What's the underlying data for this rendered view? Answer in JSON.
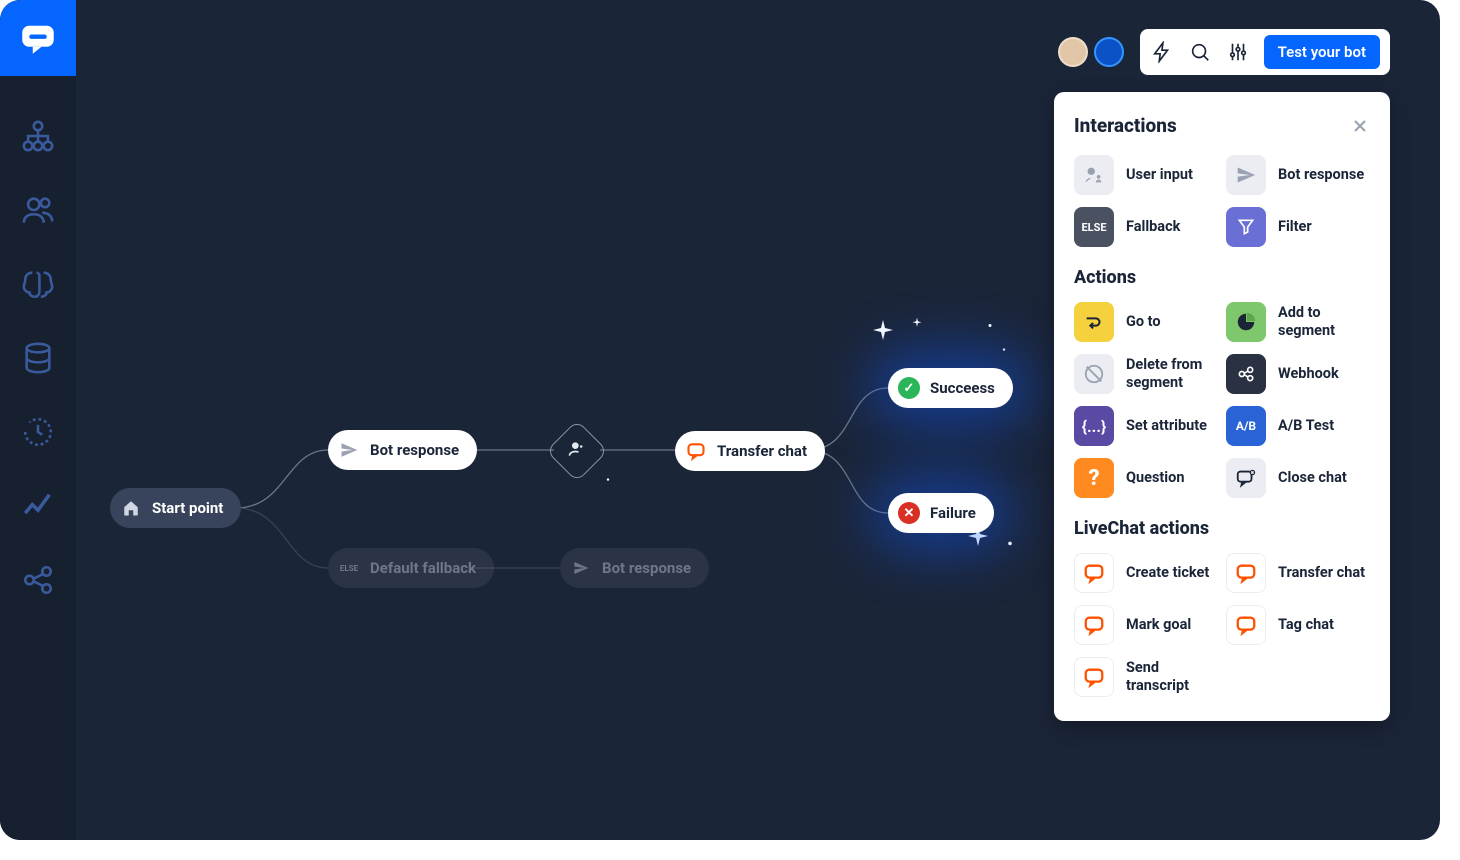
{
  "toolbar": {
    "test_label": "Test your bot"
  },
  "flow": {
    "start": "Start point",
    "bot_response_1": "Bot response",
    "transfer": "Transfer chat",
    "success": "Succeess",
    "failure": "Failure",
    "fallback": "Default fallback",
    "bot_response_2": "Bot response"
  },
  "panel": {
    "title": "Interactions",
    "sections": {
      "interactions": [
        {
          "label": "User input"
        },
        {
          "label": "Bot response"
        },
        {
          "label": "Fallback",
          "badge": "ELSE"
        },
        {
          "label": "Filter"
        }
      ],
      "actions_title": "Actions",
      "actions": [
        {
          "label": "Go to"
        },
        {
          "label": "Add to segment"
        },
        {
          "label": "Delete from segment"
        },
        {
          "label": "Webhook"
        },
        {
          "label": "Set attribute",
          "badge": "{...}"
        },
        {
          "label": "A/B Test",
          "badge": "A/B"
        },
        {
          "label": "Question",
          "badge": "?"
        },
        {
          "label": "Close chat"
        }
      ],
      "livechat_title": "LiveChat actions",
      "livechat": [
        {
          "label": "Create ticket"
        },
        {
          "label": "Transfer chat"
        },
        {
          "label": "Mark goal"
        },
        {
          "label": "Tag chat"
        },
        {
          "label": "Send transcript"
        }
      ]
    }
  }
}
